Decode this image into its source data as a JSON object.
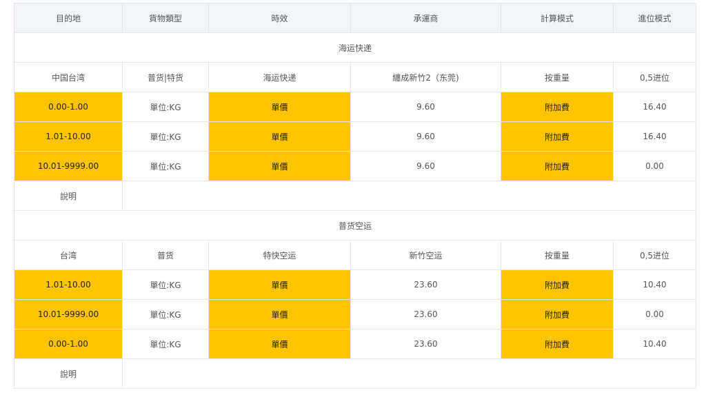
{
  "header": {
    "columns": [
      "目的地",
      "貨物類型",
      "時效",
      "承運商",
      "計算模式",
      "進位模式"
    ]
  },
  "sections": [
    {
      "title": "海运快递",
      "info": [
        "中国台湾",
        "普货|特货",
        "海运快递",
        "纏成新竹2（东莞)",
        "按重量",
        "0,5进位"
      ],
      "rows": [
        [
          "0.00-1.00",
          "單位:KG",
          "單價",
          "9.60",
          "附加費",
          "16.40"
        ],
        [
          "1.01-10.00",
          "單位:KG",
          "單價",
          "9.60",
          "附加費",
          "16.40"
        ],
        [
          "10.01-9999.00",
          "單位:KG",
          "單價",
          "9.60",
          "附加費",
          "0.00"
        ]
      ],
      "note_label": "說明"
    },
    {
      "title": "普货空运",
      "info": [
        "台湾",
        "普货",
        "特快空运",
        "新竹空运",
        "按重量",
        "0,5进位"
      ],
      "rows": [
        [
          "1.01-10.00",
          "單位:KG",
          "單價",
          "23.60",
          "附加費",
          "10.40"
        ],
        [
          "10.01-9999.00",
          "單位:KG",
          "單價",
          "23.60",
          "附加費",
          "0.00"
        ],
        [
          "0.00-1.00",
          "單位:KG",
          "單價",
          "23.60",
          "附加費",
          "10.40"
        ]
      ],
      "note_label": "說明"
    }
  ],
  "colors": {
    "highlight": "#ffc400",
    "header_bg": "#f2f5fa",
    "border": "#e2e6ec"
  }
}
